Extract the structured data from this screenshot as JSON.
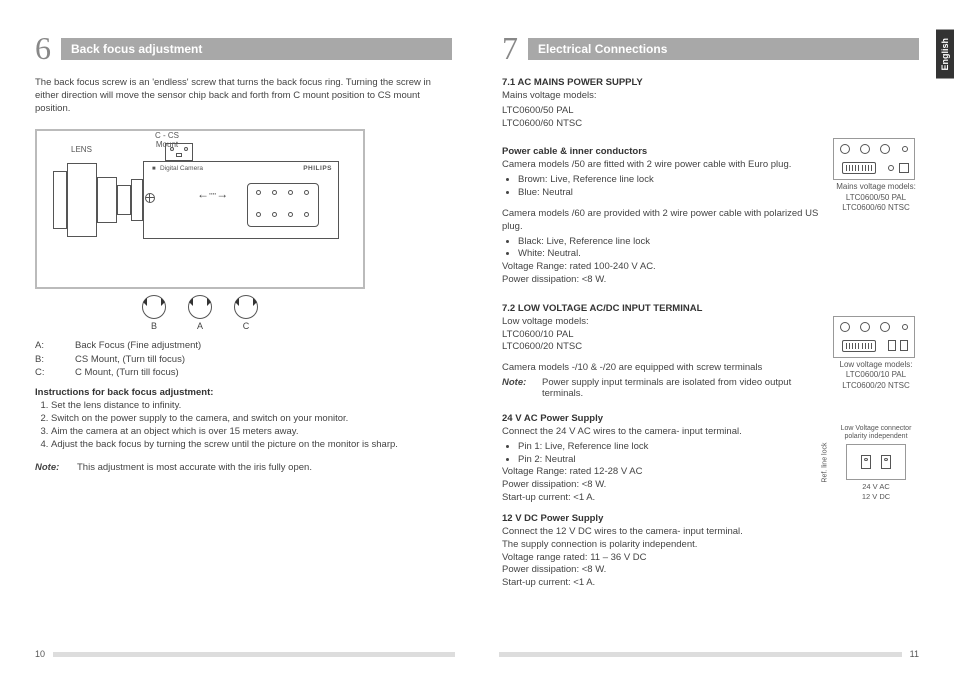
{
  "langTab": "English",
  "left": {
    "num": "6",
    "title": "Back focus adjustment",
    "intro": "The back focus screw is an 'endless' screw that turns the back focus ring. Turning the screw in either direction will move the sensor chip back and forth from C mount position to CS mount position.",
    "diag": {
      "lens": "LENS",
      "mount": "C - CS\nMount",
      "dcLabel": "Digital Camera",
      "brand": "PHILIPS",
      "b": "B",
      "a": "A",
      "c": "C"
    },
    "legend": {
      "a": "Back Focus (Fine adjustment)",
      "b": "CS Mount, (Turn till focus)",
      "c": "C Mount, (Turn till focus)"
    },
    "instrHead": "Instructions for back focus adjustment:",
    "steps": [
      "Set the lens distance to infinity.",
      "Switch on the power supply to the camera, and switch on your monitor.",
      "Aim the camera at an object which is over 15 meters away.",
      "Adjust the back focus by turning the screw until the picture on the monitor is sharp."
    ],
    "noteK": "Note:",
    "noteV": "This adjustment is most accurate with the iris fully open.",
    "pageNum": "10"
  },
  "right": {
    "num": "7",
    "title": "Electrical Connections",
    "s71head": "7.1  AC MAINS POWER SUPPLY",
    "mainsLine": "Mains voltage models:",
    "mains1": "LTC0600/50 PAL",
    "mains2": "LTC0600/60 NTSC",
    "pcHead": "Power cable & inner conductors",
    "pc50": "Camera models  /50 are fitted with 2 wire power cable with Euro plug.",
    "pc50a": "Brown: Live, Reference line lock",
    "pc50b": "Blue: Neutral",
    "pc60": "Camera models  /60 are provided with 2 wire power cable with polarized US plug.",
    "pc60a": "Black: Live, Reference line lock",
    "pc60b": "White: Neutral.",
    "vr1": "Voltage Range: rated 100-240 V AC.",
    "pd1": "Power dissipation: <8 W.",
    "fig1cap": "Mains voltage models:\nLTC0600/50 PAL\nLTC0600/60 NTSC",
    "s72head": "7.2  LOW VOLTAGE AC/DC INPUT TERMINAL",
    "lvLine": "Low voltage models:",
    "lv1": "LTC0600/10 PAL",
    "lv2": "LTC0600/20 NTSC",
    "lvEq": "Camera models -/10 & -/20 are equipped with screw terminals",
    "noteK": "Note:",
    "noteV": "Power supply input terminals are isolated from video output terminals.",
    "fig2cap": "Low voltage models:\nLTC0600/10 PAL\nLTC0600/20 NTSC",
    "p24h": "24 V AC Power Supply",
    "p24t": "Connect the 24 V AC wires to the camera- input terminal.",
    "p24a": "Pin 1: Live, Reference line lock",
    "p24b": "Pin 2: Neutral",
    "p24vr": "Voltage Range: rated 12-28 V AC",
    "p24pd": "Power dissipation: <8 W.",
    "p24sc": "Start-up current: <1 A.",
    "p12h": "12 V DC Power Supply",
    "p12t": "Connect the 12 V DC wires to the camera- input terminal.",
    "p12s": "The supply connection is polarity independent.",
    "p12vr": "Voltage range rated: 11 – 36 V DC",
    "p12pd": "Power dissipation: <8 W.",
    "p12sc": "Start-up current: <1 A.",
    "lvTop": "Low Voltage connector\npolarity independent",
    "lvSide": "Ref. line  lock",
    "lvBot": "24 V AC\n12 V DC",
    "pageNum": "11"
  }
}
